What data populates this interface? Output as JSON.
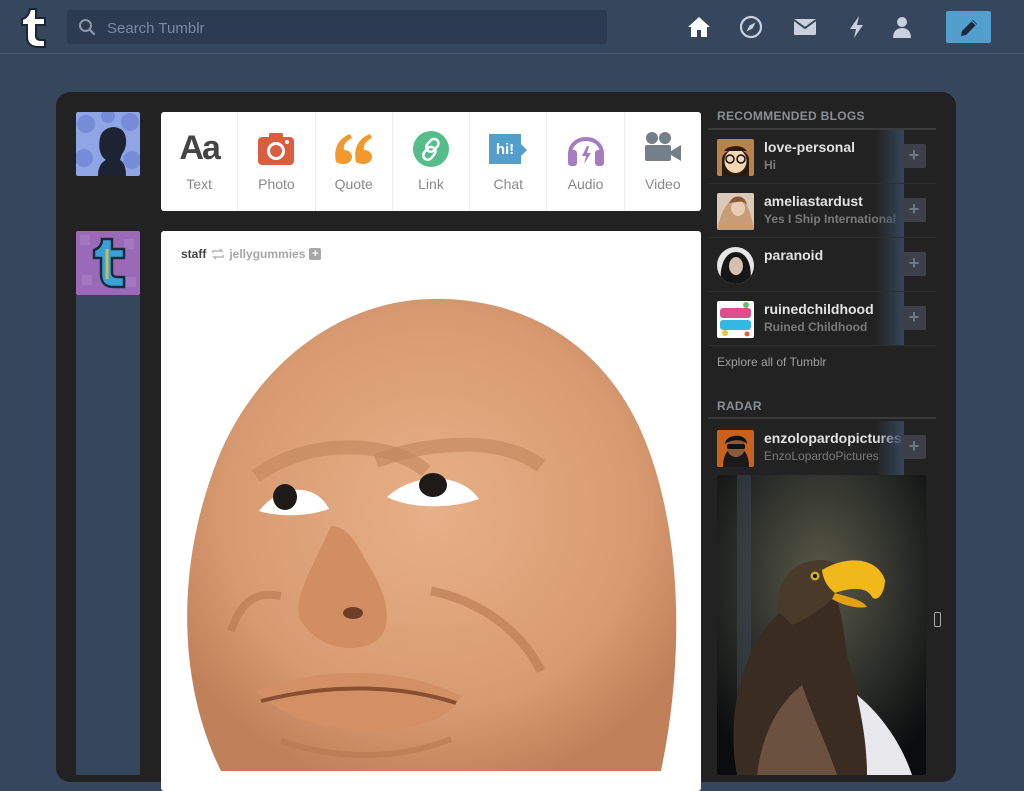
{
  "header": {
    "search_placeholder": "Search Tumblr",
    "nav_icons": [
      "home-icon",
      "explore-icon",
      "inbox-icon",
      "activity-icon",
      "account-icon"
    ],
    "compose_icon": "pencil-icon",
    "colors": {
      "background": "#36465d",
      "search": "#2c3b50",
      "compose": "#529ecc"
    }
  },
  "post_types": [
    {
      "label": "Text",
      "icon": "text-icon",
      "color": "#444444"
    },
    {
      "label": "Photo",
      "icon": "photo-icon",
      "color": "#d95e40"
    },
    {
      "label": "Quote",
      "icon": "quote-icon",
      "color": "#f2992e"
    },
    {
      "label": "Link",
      "icon": "link-icon",
      "color": "#56bc8a"
    },
    {
      "label": "Chat",
      "icon": "chat-icon",
      "color": "#529ecc"
    },
    {
      "label": "Audio",
      "icon": "audio-icon",
      "color": "#a77dc2"
    },
    {
      "label": "Video",
      "icon": "video-icon",
      "color": "#748089"
    }
  ],
  "post": {
    "author": "staff",
    "reblogged_from": "jellygummies"
  },
  "sidebar": {
    "recommended_title": "RECOMMENDED BLOGS",
    "recommended": [
      {
        "name": "love-personal",
        "title": "Hi"
      },
      {
        "name": "ameliastardust",
        "title": "Yes I Ship International"
      },
      {
        "name": "paranoid",
        "title": ""
      },
      {
        "name": "ruinedchildhood",
        "title": "Ruined Childhood"
      }
    ],
    "explore_link": "Explore all of Tumblr",
    "radar_title": "RADAR",
    "radar": {
      "name": "enzolopardopictures",
      "title": "EnzoLopardoPictures"
    },
    "follow_symbol": "+"
  }
}
